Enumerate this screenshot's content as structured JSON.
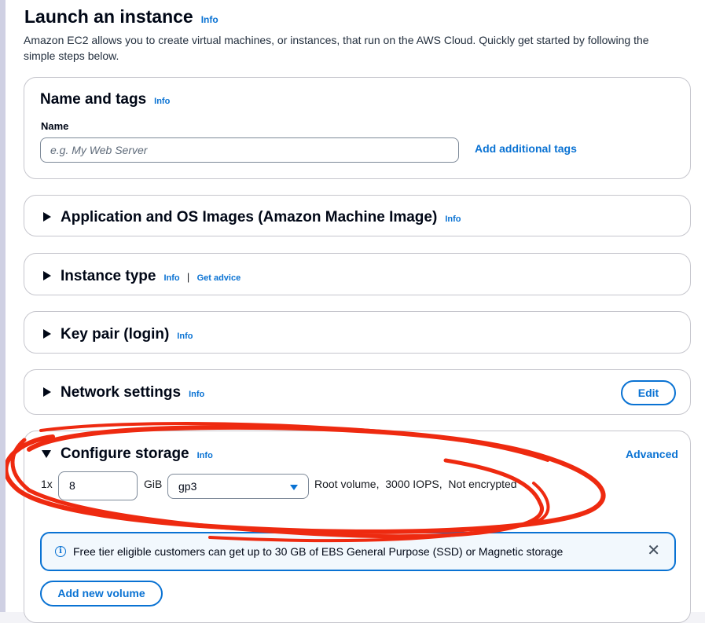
{
  "header": {
    "title": "Launch an instance",
    "info": "Info",
    "description": "Amazon EC2 allows you to create virtual machines, or instances, that run on the AWS Cloud. Quickly get started by following the simple steps below."
  },
  "name_and_tags": {
    "title": "Name and tags",
    "info": "Info",
    "name_label": "Name",
    "name_placeholder": "e.g. My Web Server",
    "add_tags_link": "Add additional tags"
  },
  "sections": {
    "ami": {
      "title": "Application and OS Images (Amazon Machine Image)",
      "info": "Info"
    },
    "instance_type": {
      "title": "Instance type",
      "info": "Info",
      "separator": "|",
      "advice_link": "Get advice"
    },
    "key_pair": {
      "title": "Key pair (login)",
      "info": "Info"
    },
    "network": {
      "title": "Network settings",
      "info": "Info",
      "edit_button": "Edit"
    }
  },
  "storage": {
    "title": "Configure storage",
    "info": "Info",
    "advanced_link": "Advanced",
    "multiplier": "1x",
    "size_value": "8",
    "unit": "GiB",
    "volume_type": "gp3",
    "volume_details": "Root volume,  3000 IOPS,  Not encrypted",
    "alert_text": "Free tier eligible customers can get up to 30 GB of EBS General Purpose (SSD) or Magnetic storage",
    "add_volume_button": "Add new volume"
  },
  "icons": {
    "collapsed": "caret-right-icon",
    "expanded": "caret-down-icon",
    "select": "dropdown-arrow-icon",
    "alert": "info-circle-icon",
    "dismiss": "close-icon"
  },
  "colors": {
    "link": "#0972d3",
    "annotation": "#ee2a10",
    "text": "#000716",
    "border": "#c6c6cd"
  }
}
